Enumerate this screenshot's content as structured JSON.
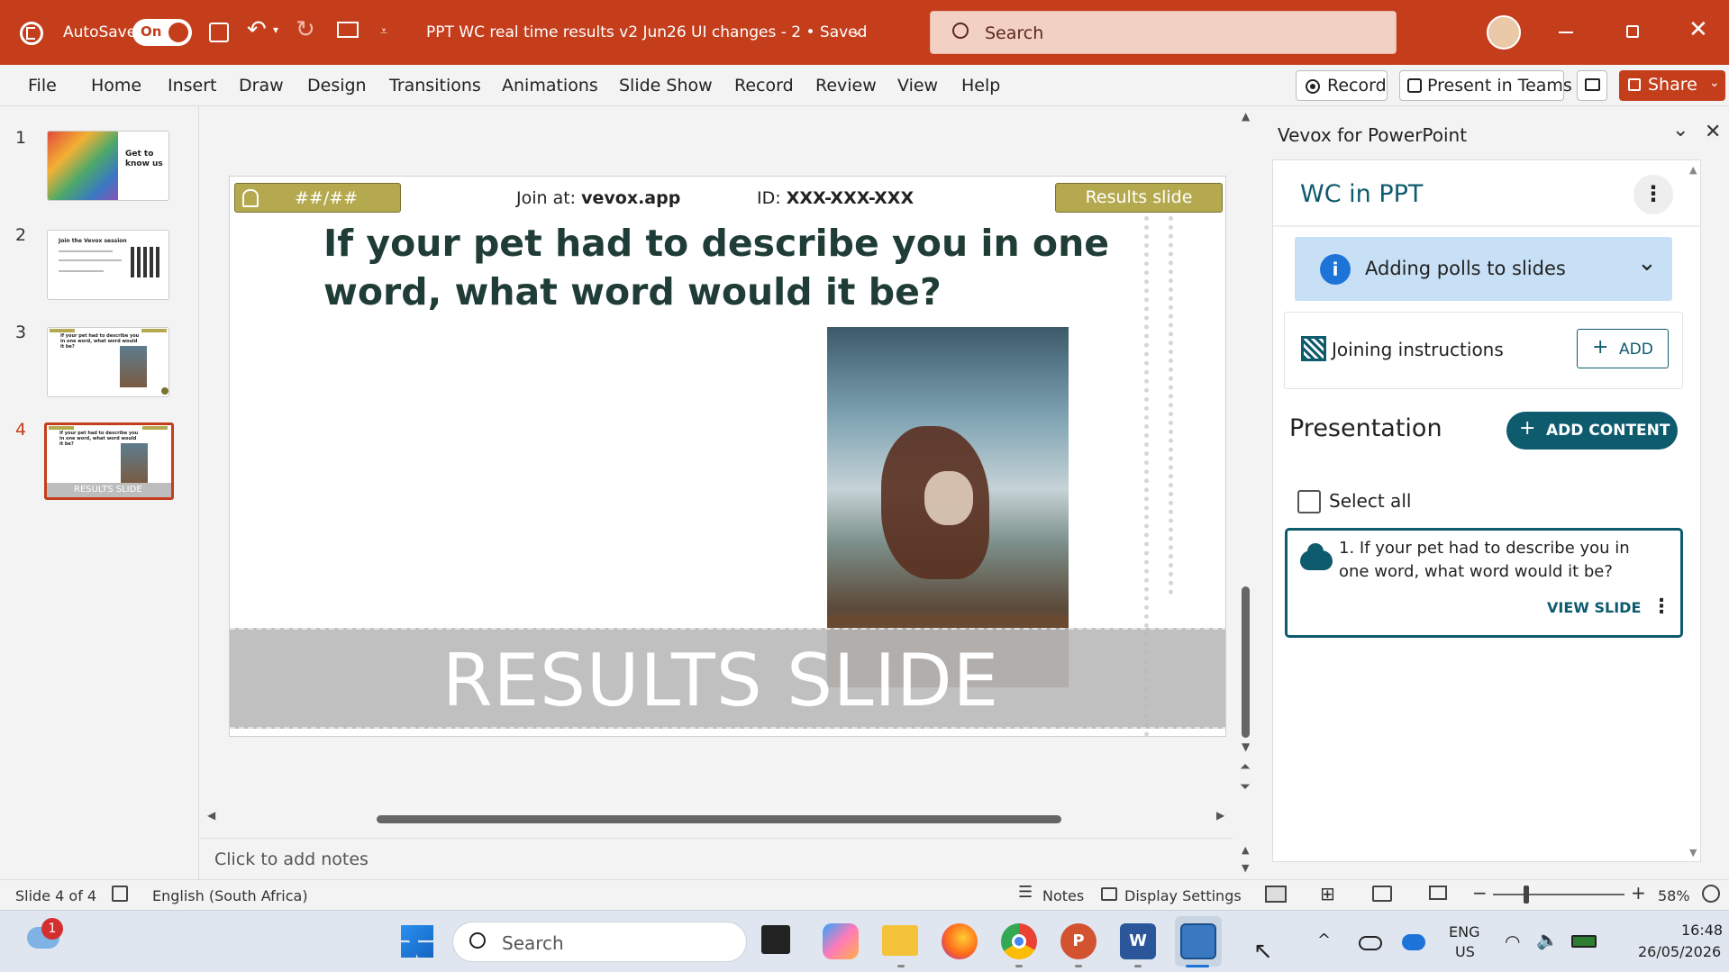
{
  "titlebar": {
    "autosave_label": "AutoSave",
    "autosave_state": "On",
    "doc_title": "PPT WC real time results v2 Jun26 UI changes  -  2  •  Saved",
    "search_placeholder": "Search"
  },
  "menu": {
    "items": [
      "File",
      "Home",
      "Insert",
      "Draw",
      "Design",
      "Transitions",
      "Animations",
      "Slide Show",
      "Record",
      "Review",
      "View",
      "Help"
    ],
    "record_button": "Record",
    "present_teams_button": "Present in Teams",
    "share_button": "Share"
  },
  "thumbnails": {
    "numbers": [
      "1",
      "2",
      "3",
      "4"
    ],
    "t1_title": "Get to know us",
    "t2_title": "Join the Vevox session",
    "t3_text": "If your pet had to describe you in one word, what word would it be?",
    "t4_text": "If your pet had to describe you in one word, what word would it be?",
    "t4_banner": "RESULTS SLIDE"
  },
  "slide": {
    "counter": "##/##",
    "join_prefix": "Join at: ",
    "join_url": "vevox.app",
    "id_prefix": "ID: ",
    "id_value": "XXX-XXX-XXX",
    "results_label": "Results slide",
    "question": "If your pet had to describe you in one word, what word would it be?",
    "banner": "RESULTS SLIDE"
  },
  "notes": {
    "placeholder": "Click to add notes"
  },
  "pane": {
    "title": "Vevox for PowerPoint",
    "session_name": "WC in PPT",
    "info_label": "Adding polls to slides",
    "joining_label": "Joining instructions",
    "add_button": "ADD",
    "presentation_heading": "Presentation",
    "add_content_button": "ADD CONTENT",
    "select_all_label": "Select all",
    "poll_title": "1. If your pet had to describe you in one word, what word would it be?",
    "view_slide_button": "VIEW SLIDE"
  },
  "status": {
    "slide_counter": "Slide 4 of 4",
    "language": "English (South Africa)",
    "notes_label": "Notes",
    "display_settings_label": "Display Settings",
    "zoom": "58%"
  },
  "taskbar": {
    "weather_badge": "1",
    "search_placeholder": "Search",
    "lang_line1": "ENG",
    "lang_line2": "US",
    "time": "16:48",
    "date": "26/05/2026"
  },
  "colors": {
    "brand": "#c43e1c",
    "vevox_teal": "#0e5b6e",
    "olive": "#b5a94f"
  }
}
